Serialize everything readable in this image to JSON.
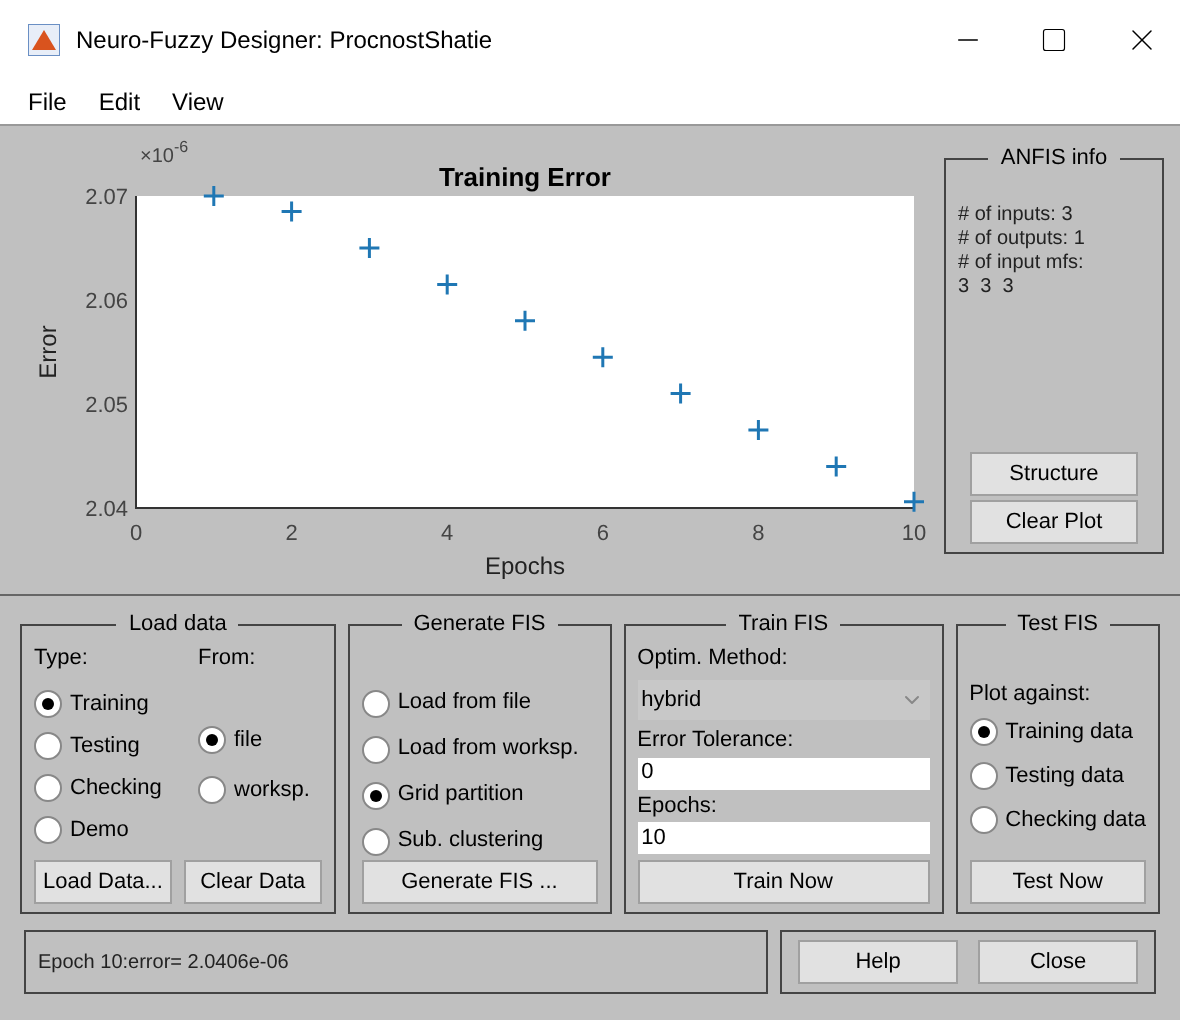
{
  "window": {
    "title": "Neuro-Fuzzy Designer: ProcnostShatie"
  },
  "menu": [
    "File",
    "Edit",
    "View"
  ],
  "plot": {
    "chart_data": {
      "type": "scatter",
      "title": "Training Error",
      "xlabel": "Epochs",
      "ylabel": "Error",
      "x": [
        1,
        2,
        3,
        4,
        5,
        6,
        7,
        8,
        9,
        10
      ],
      "series": [
        {
          "color": "#1f77b4",
          "values": [
            2.07,
            2.0685,
            2.065,
            2.0615,
            2.058,
            2.0545,
            2.051,
            2.0475,
            2.044,
            2.0406
          ]
        }
      ],
      "xlim": [
        0,
        10
      ],
      "ylim": [
        2.04,
        2.07
      ],
      "xticks": [
        {
          "value": 0,
          "label": "0"
        },
        {
          "value": 2,
          "label": "2"
        },
        {
          "value": 4,
          "label": "4"
        },
        {
          "value": 6,
          "label": "6"
        },
        {
          "value": 8,
          "label": "8"
        },
        {
          "value": 10,
          "label": "10"
        }
      ],
      "yticks": [
        {
          "value": 2.04,
          "label": "2.04"
        },
        {
          "value": 2.05,
          "label": "2.05"
        },
        {
          "value": 2.06,
          "label": "2.06"
        },
        {
          "value": 2.07,
          "label": "2.07"
        }
      ]
    },
    "multiplier_base": "×10",
    "multiplier_exponent": "-6"
  },
  "anfis_info": {
    "title": "ANFIS info",
    "lines": [
      "# of inputs: 3",
      "# of outputs: 1",
      "# of input mfs:",
      "3  3  3"
    ],
    "buttons": [
      "Structure",
      "Clear Plot"
    ]
  },
  "load_data": {
    "title": "Load data",
    "type_label": "Type:",
    "from_label": "From:",
    "types": [
      {
        "label": "Training",
        "selected": true
      },
      {
        "label": "Testing",
        "selected": false
      },
      {
        "label": "Checking",
        "selected": false
      },
      {
        "label": "Demo",
        "selected": false
      }
    ],
    "sources": [
      {
        "label": "file",
        "selected": true
      },
      {
        "label": "worksp.",
        "selected": false
      }
    ],
    "buttons": [
      "Load Data...",
      "Clear Data"
    ]
  },
  "generate_fis": {
    "title": "Generate FIS",
    "options": [
      {
        "label": "Load from file",
        "selected": false
      },
      {
        "label": "Load from worksp.",
        "selected": false
      },
      {
        "label": "Grid partition",
        "selected": true
      },
      {
        "label": "Sub. clustering",
        "selected": false
      }
    ],
    "button": "Generate FIS ..."
  },
  "train_fis": {
    "title": "Train FIS",
    "method_label": "Optim. Method:",
    "method": "hybrid",
    "tolerance_label": "Error Tolerance:",
    "tolerance": "0",
    "epochs_label": "Epochs:",
    "epochs": "10",
    "button": "Train Now"
  },
  "test_fis": {
    "title": "Test FIS",
    "plot_label": "Plot against:",
    "options": [
      {
        "label": "Training data",
        "selected": true
      },
      {
        "label": "Testing data",
        "selected": false
      },
      {
        "label": "Checking data",
        "selected": false
      }
    ],
    "button": "Test Now"
  },
  "status": "Epoch 10:error= 2.0406e-06",
  "buttons": [
    "Help",
    "Close"
  ]
}
